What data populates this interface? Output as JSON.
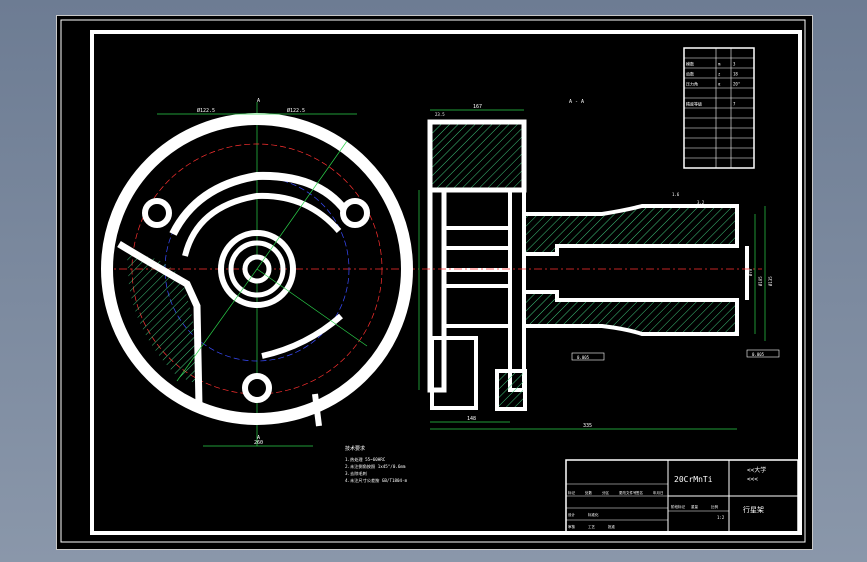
{
  "section_label": "A - A",
  "cut_marks": [
    "A",
    "A"
  ],
  "material": "20CrMnTi",
  "title_block": {
    "company": "<<大学",
    "company_sub": "<<<",
    "part_name": "行星架",
    "scale": "1:2",
    "row_labels": [
      "标记",
      "处数",
      "分区",
      "更改文件号",
      "签名",
      "年月日"
    ],
    "row_labels2": [
      "设计",
      "标准化",
      "阶段标记",
      "重量",
      "比例"
    ],
    "row_labels3": [
      "审核",
      "工艺",
      "批准"
    ]
  },
  "tech_requirements": {
    "title": "技术要求",
    "items": [
      "1.热处理 55~60HRC",
      "2.未注倒角按照 1x45°/0.6mm",
      "3.去除毛刺",
      "4.未注尺寸公差按 GB/T1804-m"
    ]
  },
  "param_table": {
    "rows": [
      [
        "",
        "",
        ""
      ],
      [
        "模数",
        "m",
        "3"
      ],
      [
        "齿数",
        "z",
        "18"
      ],
      [
        "压力角",
        "α",
        "20°"
      ],
      [
        "",
        "",
        ""
      ],
      [
        "精度等级",
        "",
        "7"
      ],
      [
        "",
        "",
        ""
      ],
      [
        "",
        "",
        ""
      ],
      [
        "",
        "",
        ""
      ],
      [
        "",
        "",
        ""
      ],
      [
        "",
        "",
        ""
      ],
      [
        "",
        "",
        ""
      ]
    ]
  },
  "dimensions": {
    "front_left": "Ø122.5",
    "front_right": "Ø122.5",
    "front_bottom": "260",
    "section_top": "167",
    "section_top_small": "23.5",
    "section_bottom_left": "148",
    "section_bottom": "335",
    "section_left_height": "175",
    "right_dia_1": "Ø70",
    "right_dia_2": "Ø105",
    "right_dia_3": "Ø135",
    "roughness_1": "3.2",
    "roughness_2": "1.6",
    "tol_1": "0.005",
    "tol_2": "0.005"
  },
  "colors": {
    "background": "#000000",
    "part_outline": "#ffffff",
    "center_line_red": "#ff3030",
    "dim_green": "#2bd24b",
    "pitch_blue": "#3a4cff",
    "hatch": "#3fc47b"
  }
}
